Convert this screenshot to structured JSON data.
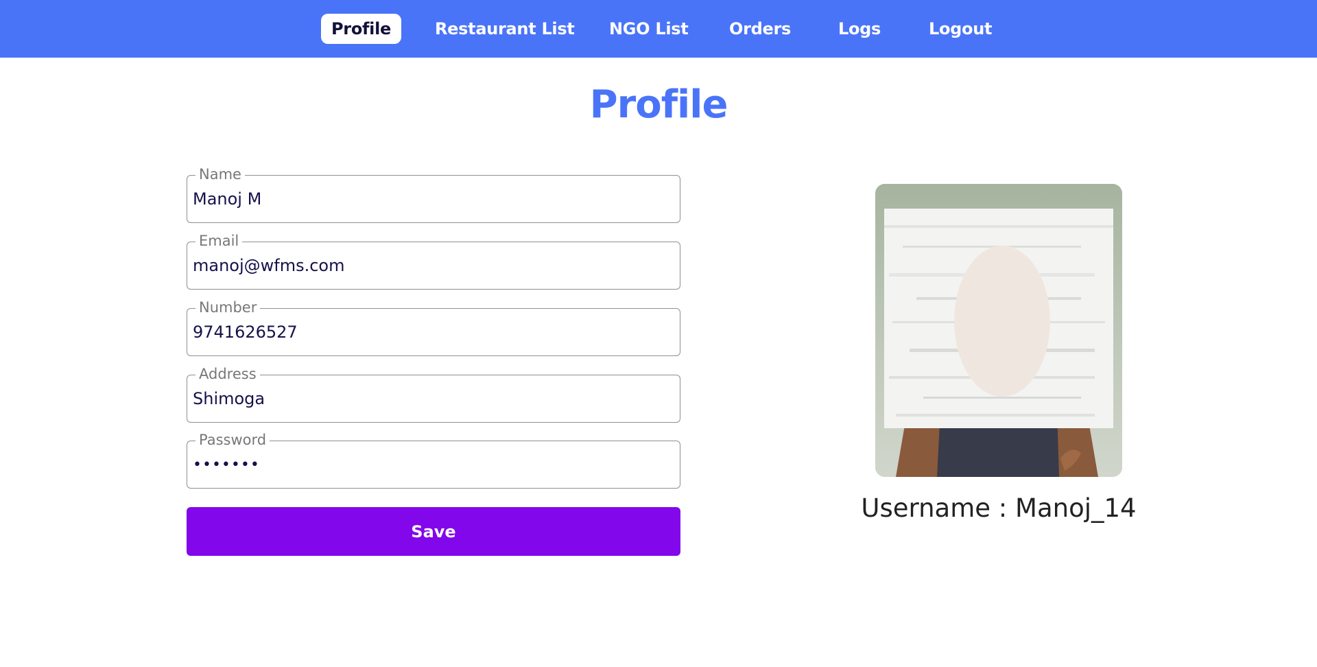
{
  "nav": {
    "items": [
      {
        "label": "Profile",
        "active": true
      },
      {
        "label": "Restaurant List",
        "active": false
      },
      {
        "label": "NGO List",
        "active": false
      },
      {
        "label": "Orders",
        "active": false
      },
      {
        "label": "Logs",
        "active": false
      },
      {
        "label": "Logout",
        "active": false
      }
    ]
  },
  "page": {
    "title": "Profile"
  },
  "form": {
    "name": {
      "label": "Name",
      "value": "Manoj M"
    },
    "email": {
      "label": "Email",
      "value": "manoj@wfms.com"
    },
    "number": {
      "label": "Number",
      "value": "9741626527"
    },
    "address": {
      "label": "Address",
      "value": "Shimoga"
    },
    "password": {
      "label": "Password",
      "value": "•••••••"
    },
    "save_label": "Save"
  },
  "profile": {
    "username_text": "Username : Manoj_14"
  },
  "colors": {
    "nav_background": "#4a74f8",
    "title": "#4a74f8",
    "save_button": "#8207ea",
    "input_text": "#15114a"
  }
}
